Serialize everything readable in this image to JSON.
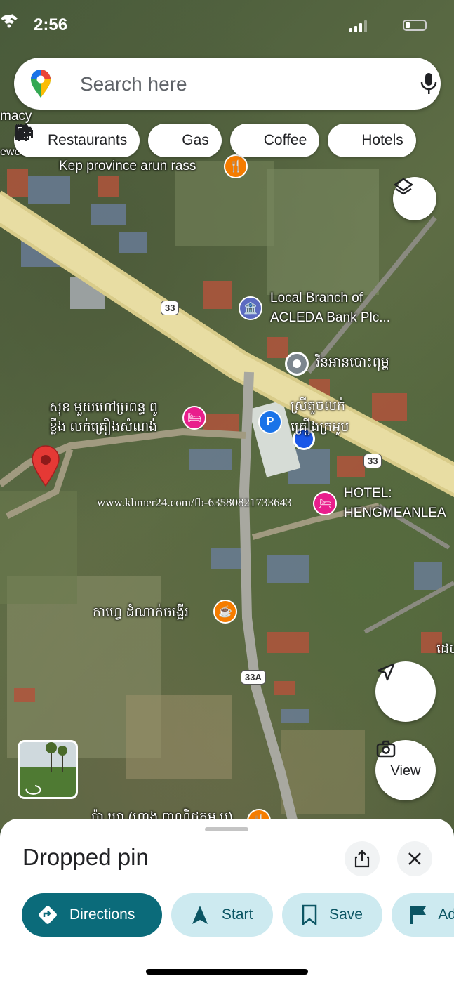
{
  "status_bar": {
    "time": "2:56"
  },
  "search": {
    "placeholder": "Search here"
  },
  "chips": [
    {
      "label": "Restaurants",
      "icon": "fork-knife-icon"
    },
    {
      "label": "Gas",
      "icon": "gas-pump-icon"
    },
    {
      "label": "Coffee",
      "icon": "coffee-cup-icon"
    },
    {
      "label": "Hotels",
      "icon": "bed-icon"
    }
  ],
  "map": {
    "labels": {
      "arun_rass": "Kep province arun rass",
      "acleda_1": "Local Branch of",
      "acleda_2": "ACLEDA Bank Plc...",
      "khmer_temple": "វិនអានបោះពុម្ព",
      "khmer_shop_1": "ស្រីតូចលក់",
      "khmer_shop_2": "គ្រឿងក្រអូប",
      "khmer_hotel_1": "សុខ មួយហៅប្រពន្ធ ពូ",
      "khmer_hotel_2": "ខ្លឹង លក់គ្រឿងសំណង់",
      "hotel_1": "HOTEL:",
      "hotel_2": "HENGMEANLEA",
      "cafe": "កាហ្វេ ដំណាក់ចង្អេីរ",
      "edge_top_1": "macy",
      "edge_top_2": "ewed",
      "edge_right": "ដេប",
      "bottom_partial": "ប៉ា ឃា (ហាង ពាណិជ្ជកម្ម ប)"
    },
    "shields": {
      "r33_a": "33",
      "r33_b": "33",
      "r33a": "33A"
    }
  },
  "watermark": "www.khmer24.com/fb-63580821733643",
  "view_button": {
    "label": "View"
  },
  "sheet": {
    "title": "Dropped pin",
    "actions": [
      {
        "label": "Directions",
        "icon": "directions-icon"
      },
      {
        "label": "Start",
        "icon": "navigation-arrow-icon"
      },
      {
        "label": "Save",
        "icon": "bookmark-icon"
      },
      {
        "label": "Ad",
        "icon": "flag-icon"
      }
    ]
  },
  "colors": {
    "accent": "#0b6b7a",
    "tonal": "#cdeaf0",
    "pin": "#e53935",
    "blue_dot": "#1a57e8"
  }
}
